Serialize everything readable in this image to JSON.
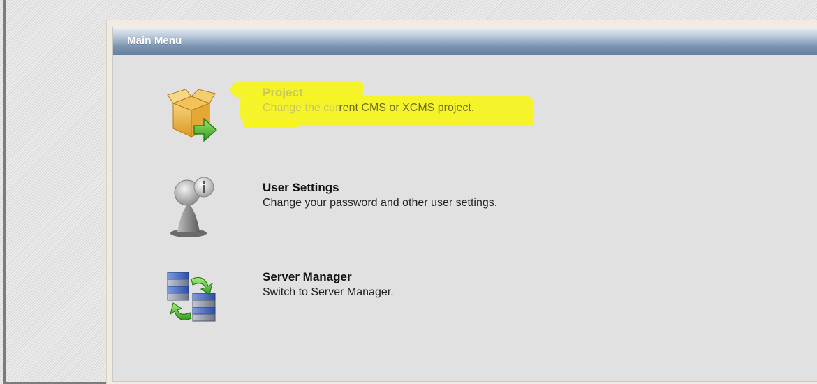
{
  "panel": {
    "title": "Main Menu"
  },
  "menu_items": [
    {
      "title": "Project",
      "description_faded": "Change the cur",
      "description_visible": "rent CMS or XCMS project.",
      "icon": "open-box-arrow-icon"
    },
    {
      "title": "User Settings",
      "description": "Change your password and other user settings.",
      "icon": "user-info-icon"
    },
    {
      "title": "Server Manager",
      "description": "Switch to Server Manager.",
      "icon": "server-sync-icon"
    }
  ],
  "colors": {
    "header_gradient_top": "#eef2f7",
    "header_gradient_bottom": "#667f9c",
    "panel_background": "#e1e1e1",
    "highlight": "#f6f51a"
  }
}
